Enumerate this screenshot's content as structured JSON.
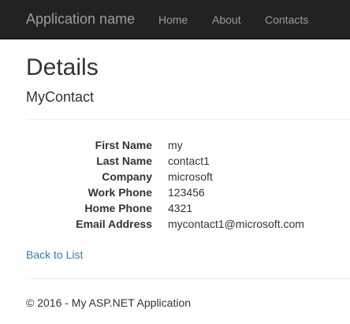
{
  "navbar": {
    "brand": "Application name",
    "links": [
      {
        "label": "Home"
      },
      {
        "label": "About"
      },
      {
        "label": "Contacts"
      }
    ]
  },
  "page": {
    "title": "Details",
    "subtitle": "MyContact"
  },
  "details": [
    {
      "label": "First Name",
      "value": "my"
    },
    {
      "label": "Last Name",
      "value": "contact1"
    },
    {
      "label": "Company",
      "value": "microsoft"
    },
    {
      "label": "Work Phone",
      "value": "123456"
    },
    {
      "label": "Home Phone",
      "value": "4321"
    },
    {
      "label": "Email Address",
      "value": "mycontact1@microsoft.com"
    }
  ],
  "actions": {
    "back_label": "Back to List"
  },
  "footer": {
    "text": "© 2016 - My ASP.NET Application"
  },
  "colors": {
    "navbar_bg": "#222222",
    "navbar_text": "#9d9d9d",
    "link": "#337ab7",
    "text": "#333333"
  }
}
